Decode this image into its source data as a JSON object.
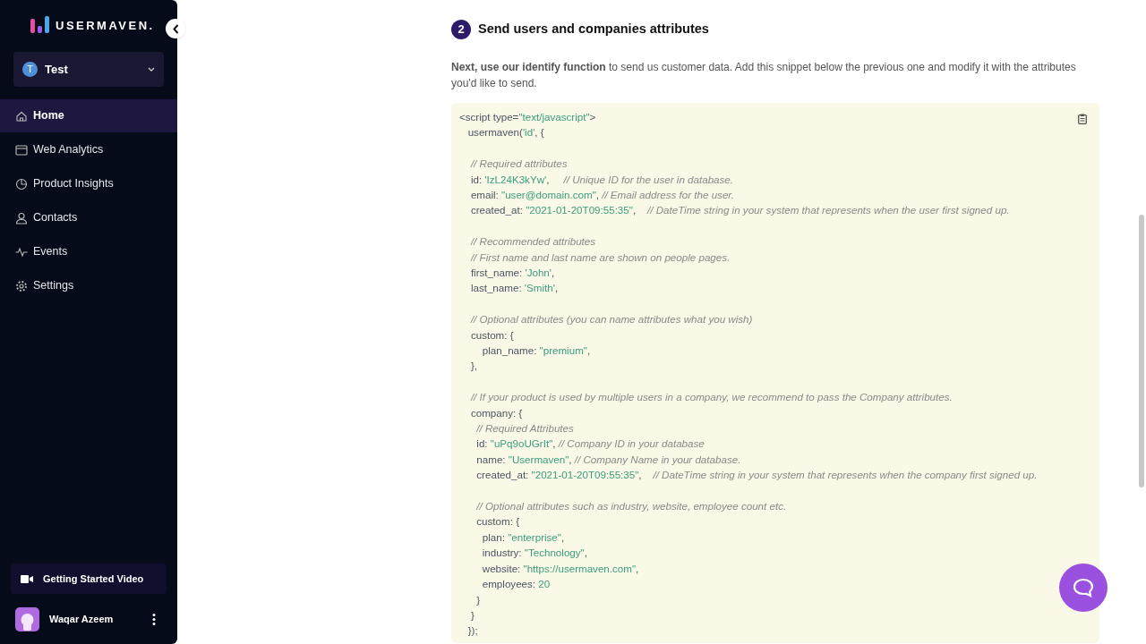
{
  "sidebar": {
    "logo": "USERMAVEN.",
    "workspace": {
      "initial": "T",
      "name": "Test"
    },
    "items": [
      {
        "label": "Home",
        "selected": true
      },
      {
        "label": "Web Analytics",
        "selected": false
      },
      {
        "label": "Product Insights",
        "selected": false
      },
      {
        "label": "Contacts",
        "selected": false
      },
      {
        "label": "Events",
        "selected": false
      },
      {
        "label": "Settings",
        "selected": false
      }
    ],
    "video_button": "Getting Started Video",
    "user": {
      "name": "Waqar Azeem"
    }
  },
  "section": {
    "step": "2",
    "title": "Send users and companies attributes",
    "intro": "**Next, use our identify function** to send us customer data. Add this snippet below the previous one and modify it with the attributes you'd like to send.",
    "code": [
      {
        "segments": [
          {
            "kind": "plain",
            "text": "<script type="
          },
          {
            "kind": "string",
            "text": "\"text/javascript\""
          },
          {
            "kind": "plain",
            "text": ">"
          }
        ]
      },
      {
        "segments": [
          {
            "kind": "plain",
            "text": "   usermaven("
          },
          {
            "kind": "string",
            "text": "'id'"
          },
          {
            "kind": "plain",
            "text": ", {"
          }
        ]
      },
      {
        "blank_before": true,
        "segments": [
          {
            "kind": "comment",
            "text": "    // Required attributes"
          }
        ]
      },
      {
        "segments": [
          {
            "kind": "plain",
            "text": "    id: "
          },
          {
            "kind": "string",
            "text": "'IzL24K3kYw'"
          },
          {
            "kind": "plain",
            "text": ",     "
          },
          {
            "kind": "comment",
            "text": "// Unique ID for the user in database."
          }
        ]
      },
      {
        "segments": [
          {
            "kind": "plain",
            "text": "    email: "
          },
          {
            "kind": "string",
            "text": "\"user@domain.com\""
          },
          {
            "kind": "plain",
            "text": ", "
          },
          {
            "kind": "comment",
            "text": "// Email address for the user."
          }
        ]
      },
      {
        "segments": [
          {
            "kind": "plain",
            "text": "    created_at: "
          },
          {
            "kind": "string",
            "text": "\"2021-01-20T09:55:35\""
          },
          {
            "kind": "plain",
            "text": ",    "
          },
          {
            "kind": "comment",
            "text": "// DateTime string in your system that represents when the user first signed up."
          }
        ]
      },
      {
        "blank_before": true,
        "segments": [
          {
            "kind": "comment",
            "text": "    // Recommended attributes"
          }
        ]
      },
      {
        "segments": [
          {
            "kind": "comment",
            "text": "    // First name and last name are shown on people pages."
          }
        ]
      },
      {
        "segments": [
          {
            "kind": "plain",
            "text": "    first_name: "
          },
          {
            "kind": "string",
            "text": "'John'"
          },
          {
            "kind": "plain",
            "text": ","
          }
        ]
      },
      {
        "segments": [
          {
            "kind": "plain",
            "text": "    last_name: "
          },
          {
            "kind": "string",
            "text": "'Smith'"
          },
          {
            "kind": "plain",
            "text": ","
          }
        ]
      },
      {
        "blank_before": true,
        "segments": [
          {
            "kind": "comment",
            "text": "    // Optional attributes (you can name attributes what you wish)"
          }
        ]
      },
      {
        "segments": [
          {
            "kind": "plain",
            "text": "    custom: {"
          }
        ]
      },
      {
        "segments": [
          {
            "kind": "plain",
            "text": "        plan_name: "
          },
          {
            "kind": "string",
            "text": "\"premium\""
          },
          {
            "kind": "plain",
            "text": ","
          }
        ]
      },
      {
        "segments": [
          {
            "kind": "plain",
            "text": "    },"
          }
        ]
      },
      {
        "blank_before": true,
        "segments": [
          {
            "kind": "comment",
            "text": "    // If your product is used by multiple users in a company, we recommend to pass the Company attributes."
          }
        ]
      },
      {
        "segments": [
          {
            "kind": "plain",
            "text": "    company: {"
          }
        ]
      },
      {
        "segments": [
          {
            "kind": "comment",
            "text": "      // Required Attributes"
          }
        ]
      },
      {
        "segments": [
          {
            "kind": "plain",
            "text": "      id: "
          },
          {
            "kind": "string",
            "text": "\"uPq9oUGrIt\""
          },
          {
            "kind": "plain",
            "text": ", "
          },
          {
            "kind": "comment",
            "text": "// Company ID in your database"
          }
        ]
      },
      {
        "segments": [
          {
            "kind": "plain",
            "text": "      name: "
          },
          {
            "kind": "string",
            "text": "\"Usermaven\""
          },
          {
            "kind": "plain",
            "text": ", "
          },
          {
            "kind": "comment",
            "text": "// Company Name in your database."
          }
        ]
      },
      {
        "segments": [
          {
            "kind": "plain",
            "text": "      created_at: "
          },
          {
            "kind": "string",
            "text": "\"2021-01-20T09:55:35\""
          },
          {
            "kind": "plain",
            "text": ",    "
          },
          {
            "kind": "comment",
            "text": "// DateTime string in your system that represents when the company first signed up."
          }
        ]
      },
      {
        "blank_before": true,
        "segments": [
          {
            "kind": "comment",
            "text": "      // Optional attributes such as industry, website, employee count etc."
          }
        ]
      },
      {
        "segments": [
          {
            "kind": "plain",
            "text": "      custom: {"
          }
        ]
      },
      {
        "segments": [
          {
            "kind": "plain",
            "text": "        plan: "
          },
          {
            "kind": "string",
            "text": "\"enterprise\""
          },
          {
            "kind": "plain",
            "text": ","
          }
        ]
      },
      {
        "segments": [
          {
            "kind": "plain",
            "text": "        industry: "
          },
          {
            "kind": "string",
            "text": "\"Technology\""
          },
          {
            "kind": "plain",
            "text": ","
          }
        ]
      },
      {
        "segments": [
          {
            "kind": "plain",
            "text": "        website: "
          },
          {
            "kind": "string",
            "text": "\"https://usermaven.com\""
          },
          {
            "kind": "plain",
            "text": ","
          }
        ]
      },
      {
        "segments": [
          {
            "kind": "plain",
            "text": "        employees: "
          },
          {
            "kind": "string",
            "text": "20"
          }
        ]
      },
      {
        "segments": [
          {
            "kind": "plain",
            "text": "      }"
          }
        ]
      },
      {
        "segments": [
          {
            "kind": "plain",
            "text": "    }"
          }
        ]
      },
      {
        "segments": [
          {
            "kind": "plain",
            "text": "   });"
          }
        ]
      }
    ]
  }
}
